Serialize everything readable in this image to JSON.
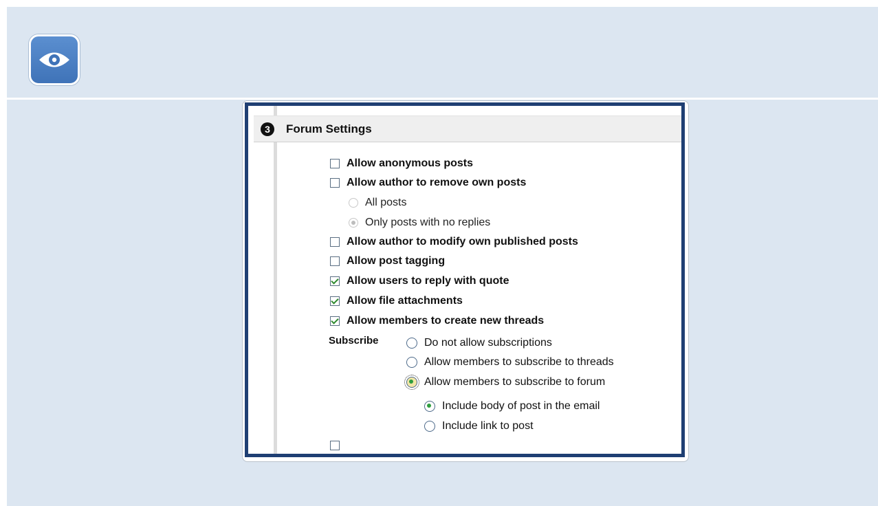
{
  "app": {
    "icon": "eye-icon",
    "colors": {
      "background": "#dce6f1",
      "frame_border": "#1f3f73",
      "checkmark": "#2f8a2f"
    }
  },
  "section": {
    "step_number": "3",
    "title": "Forum Settings"
  },
  "options": {
    "anonymous": {
      "label": "Allow anonymous posts",
      "checked": false
    },
    "remove_own": {
      "label": "Allow author to remove own posts",
      "checked": false
    },
    "remove_all_posts": {
      "label": "All posts",
      "selected": false
    },
    "remove_no_replies": {
      "label": "Only posts with no replies",
      "selected": true
    },
    "modify_own": {
      "label": "Allow author to modify own published posts",
      "checked": false
    },
    "post_tagging": {
      "label": "Allow post tagging",
      "checked": false
    },
    "reply_quote": {
      "label": "Allow users to reply with quote",
      "checked": true
    },
    "file_attachments": {
      "label": "Allow file attachments",
      "checked": true
    },
    "new_threads": {
      "label": "Allow members to create new threads",
      "checked": true
    }
  },
  "subscribe": {
    "label": "Subscribe",
    "options": [
      {
        "label": "Do not allow subscriptions",
        "selected": false
      },
      {
        "label": "Allow members to subscribe to threads",
        "selected": false
      },
      {
        "label": "Allow members to subscribe to forum",
        "selected": true
      }
    ],
    "email_options": [
      {
        "label": "Include body of post in the email",
        "selected": true
      },
      {
        "label": "Include link to post",
        "selected": false
      }
    ]
  }
}
